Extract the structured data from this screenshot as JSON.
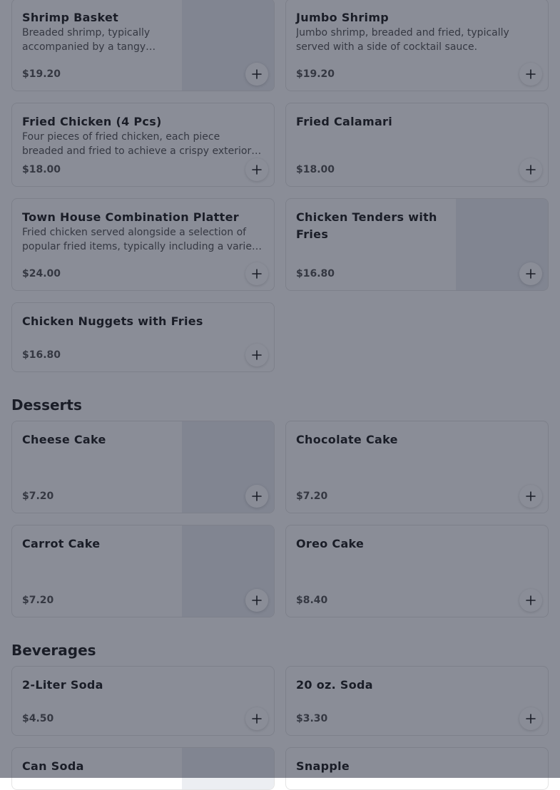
{
  "sections": {
    "desserts": "Desserts",
    "beverages": "Beverages"
  },
  "items": [
    {
      "name": "Shrimp Basket",
      "description": "Breaded shrimp, typically accompanied by a tangy…",
      "price": "$19.20",
      "has_image": true
    },
    {
      "name": "Jumbo Shrimp",
      "description": "Jumbo shrimp, breaded and fried, typically served with a side of cocktail sauce.",
      "price": "$19.20",
      "has_image": false
    },
    {
      "name": "Fried Chicken (4 Pcs)",
      "description": "Four pieces of fried chicken, each piece breaded and fried to achieve a crispy exterior…",
      "price": "$18.00",
      "has_image": false
    },
    {
      "name": "Fried Calamari",
      "description": "",
      "price": "$18.00",
      "has_image": false
    },
    {
      "name": "Town House Combination Platter",
      "description": "Fried chicken served alongside a selection of popular fried items, typically including a varie…",
      "price": "$24.00",
      "has_image": false
    },
    {
      "name": "Chicken Tenders with Fries",
      "description": "",
      "price": "$16.80",
      "has_image": true
    },
    {
      "name": "Chicken Nuggets with Fries",
      "description": "",
      "price": "$16.80",
      "has_image": false
    },
    {
      "name": "Cheese Cake",
      "description": "",
      "price": "$7.20",
      "has_image": true
    },
    {
      "name": "Chocolate Cake",
      "description": "",
      "price": "$7.20",
      "has_image": false
    },
    {
      "name": "Carrot Cake",
      "description": "",
      "price": "$7.20",
      "has_image": true
    },
    {
      "name": "Oreo Cake",
      "description": "",
      "price": "$8.40",
      "has_image": false
    },
    {
      "name": "2-Liter Soda",
      "description": "",
      "price": "$4.50",
      "has_image": false
    },
    {
      "name": "20 oz. Soda",
      "description": "",
      "price": "$3.30",
      "has_image": false
    },
    {
      "name": "Can Soda",
      "description": "",
      "price": "",
      "has_image": true
    },
    {
      "name": "Snapple",
      "description": "",
      "price": "",
      "has_image": false
    }
  ],
  "icons": {
    "add": "plus-icon"
  },
  "colors": {
    "modal_overlay": "#151b30"
  }
}
